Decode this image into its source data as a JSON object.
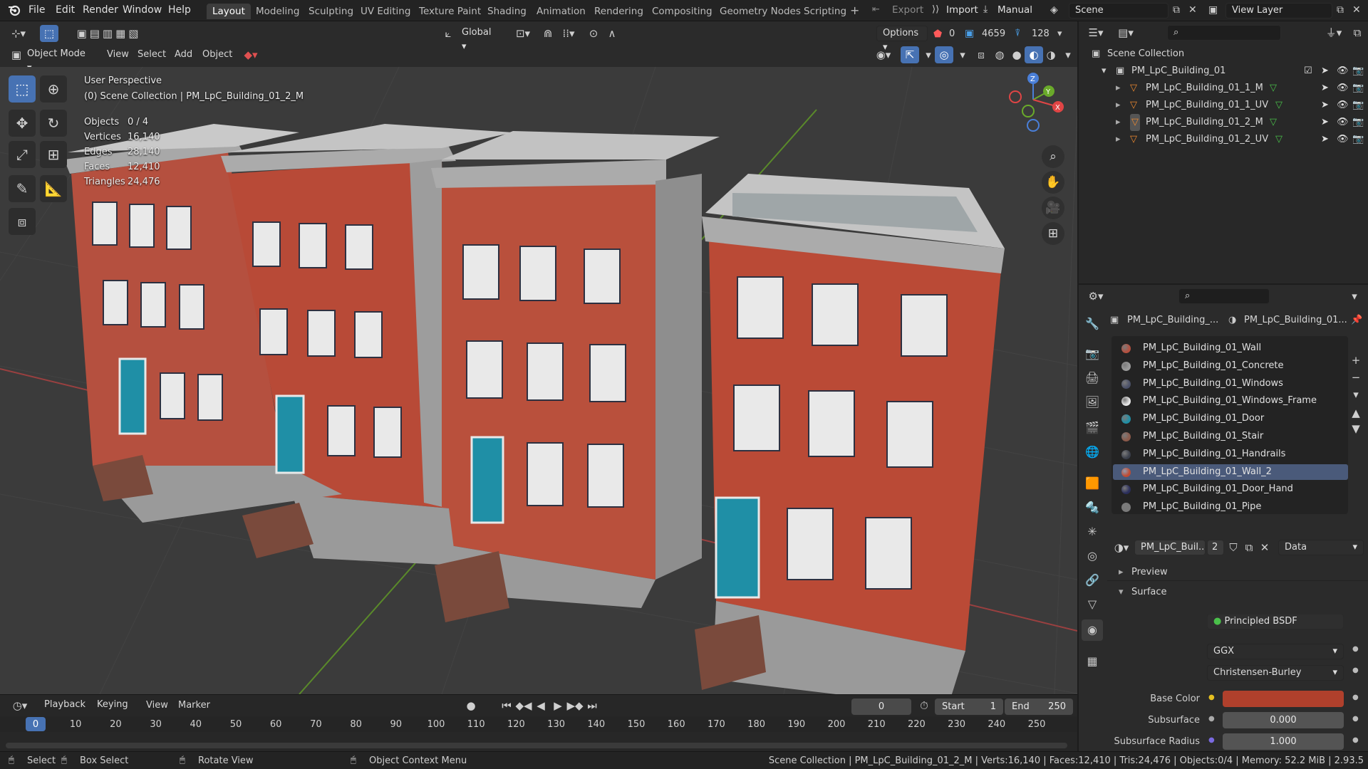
{
  "app": {
    "name": "Blender"
  },
  "top_menu": [
    "File",
    "Edit",
    "Render",
    "Window",
    "Help"
  ],
  "workspaces": [
    "Layout",
    "Modeling",
    "Sculpting",
    "UV Editing",
    "Texture Paint",
    "Shading",
    "Animation",
    "Rendering",
    "Compositing",
    "Geometry Nodes",
    "Scripting"
  ],
  "active_workspace": "Layout",
  "top_right": {
    "export_label": "Export",
    "import_label": "Import",
    "manual_label": "Manual",
    "scene_name": "Scene",
    "view_layer_name": "View Layer"
  },
  "viewport_header": {
    "transform_orientation": "Global",
    "options_label": "Options",
    "stats_counters": [
      "0",
      "4659",
      "128"
    ],
    "mode": "Object Mode",
    "menus": [
      "View",
      "Select",
      "Add",
      "Object"
    ]
  },
  "viewport": {
    "perspective": "User Perspective",
    "collection_path": "(0) Scene Collection | PM_LpC_Building_01_2_M",
    "stats": [
      {
        "label": "Objects",
        "value": "0 / 4"
      },
      {
        "label": "Vertices",
        "value": "16,140"
      },
      {
        "label": "Edges",
        "value": "28,140"
      },
      {
        "label": "Faces",
        "value": "12,410"
      },
      {
        "label": "Triangles",
        "value": "24,476"
      }
    ],
    "gizmo_axes": [
      "X",
      "Y",
      "Z"
    ]
  },
  "outliner": {
    "root": "Scene Collection",
    "collection": "PM_LpC_Building_01",
    "objects": [
      "PM_LpC_Building_01_1_M",
      "PM_LpC_Building_01_1_UV",
      "PM_LpC_Building_01_2_M",
      "PM_LpC_Building_01_2_UV"
    ]
  },
  "properties": {
    "breadcrumb_object": "PM_LpC_Building_...",
    "breadcrumb_material": "PM_LpC_Building_01...",
    "materials": [
      {
        "name": "PM_LpC_Building_01_Wall",
        "color": "#b5503f"
      },
      {
        "name": "PM_LpC_Building_01_Concrete",
        "color": "#9b9b9b"
      },
      {
        "name": "PM_LpC_Building_01_Windows",
        "color": "#4a5068"
      },
      {
        "name": "PM_LpC_Building_01_Windows_Frame",
        "color": "#e6e6e6"
      },
      {
        "name": "PM_LpC_Building_01_Door",
        "color": "#1f8fa6"
      },
      {
        "name": "PM_LpC_Building_01_Stair",
        "color": "#8c5a4a"
      },
      {
        "name": "PM_LpC_Building_01_Handrails",
        "color": "#3a3f4a"
      },
      {
        "name": "PM_LpC_Building_01_Wall_2",
        "color": "#c04a32"
      },
      {
        "name": "PM_LpC_Building_01_Door_Hand",
        "color": "#2a2e5c"
      },
      {
        "name": "PM_LpC_Building_01_Pipe",
        "color": "#7a7a7a"
      }
    ],
    "selected_material": "PM_LpC_Building_01_Wall_2",
    "material_slot_name": "PM_LpC_Buil...",
    "user_count": "2",
    "link_mode": "Data",
    "panels": {
      "preview": "Preview",
      "surface": "Surface"
    },
    "surface_label": "Surface",
    "surface_shader": "Principled BSDF",
    "distribution": "GGX",
    "subsurface_method": "Christensen-Burley",
    "base_color_label": "Base Color",
    "base_color": "#b0402c",
    "subsurface_label": "Subsurface",
    "subsurface_value": "0.000",
    "subsurface_radius_label": "Subsurface Radius",
    "subsurface_radius_value": "1.000"
  },
  "timeline": {
    "menus": [
      "Playback",
      "Keying",
      "View",
      "Marker"
    ],
    "current_frame": "0",
    "start_label": "Start",
    "start_value": "1",
    "end_label": "End",
    "end_value": "250",
    "ruler": [
      "0",
      "10",
      "20",
      "30",
      "40",
      "50",
      "60",
      "70",
      "80",
      "90",
      "100",
      "110",
      "120",
      "130",
      "140",
      "150",
      "160",
      "170",
      "180",
      "190",
      "200",
      "210",
      "220",
      "230",
      "240",
      "250"
    ]
  },
  "statusbar": {
    "select": "Select",
    "box_select": "Box Select",
    "rotate_view": "Rotate View",
    "context_menu": "Object Context Menu",
    "info": "Scene Collection | PM_LpC_Building_01_2_M | Verts:16,140 | Faces:12,410 | Tris:24,476 | Objects:0/4 | Memory: 52.2 MiB | 2.93.5"
  },
  "colors": {
    "accent": "#4772b3",
    "brick": "#b5503f",
    "door": "#1f8fa6"
  }
}
